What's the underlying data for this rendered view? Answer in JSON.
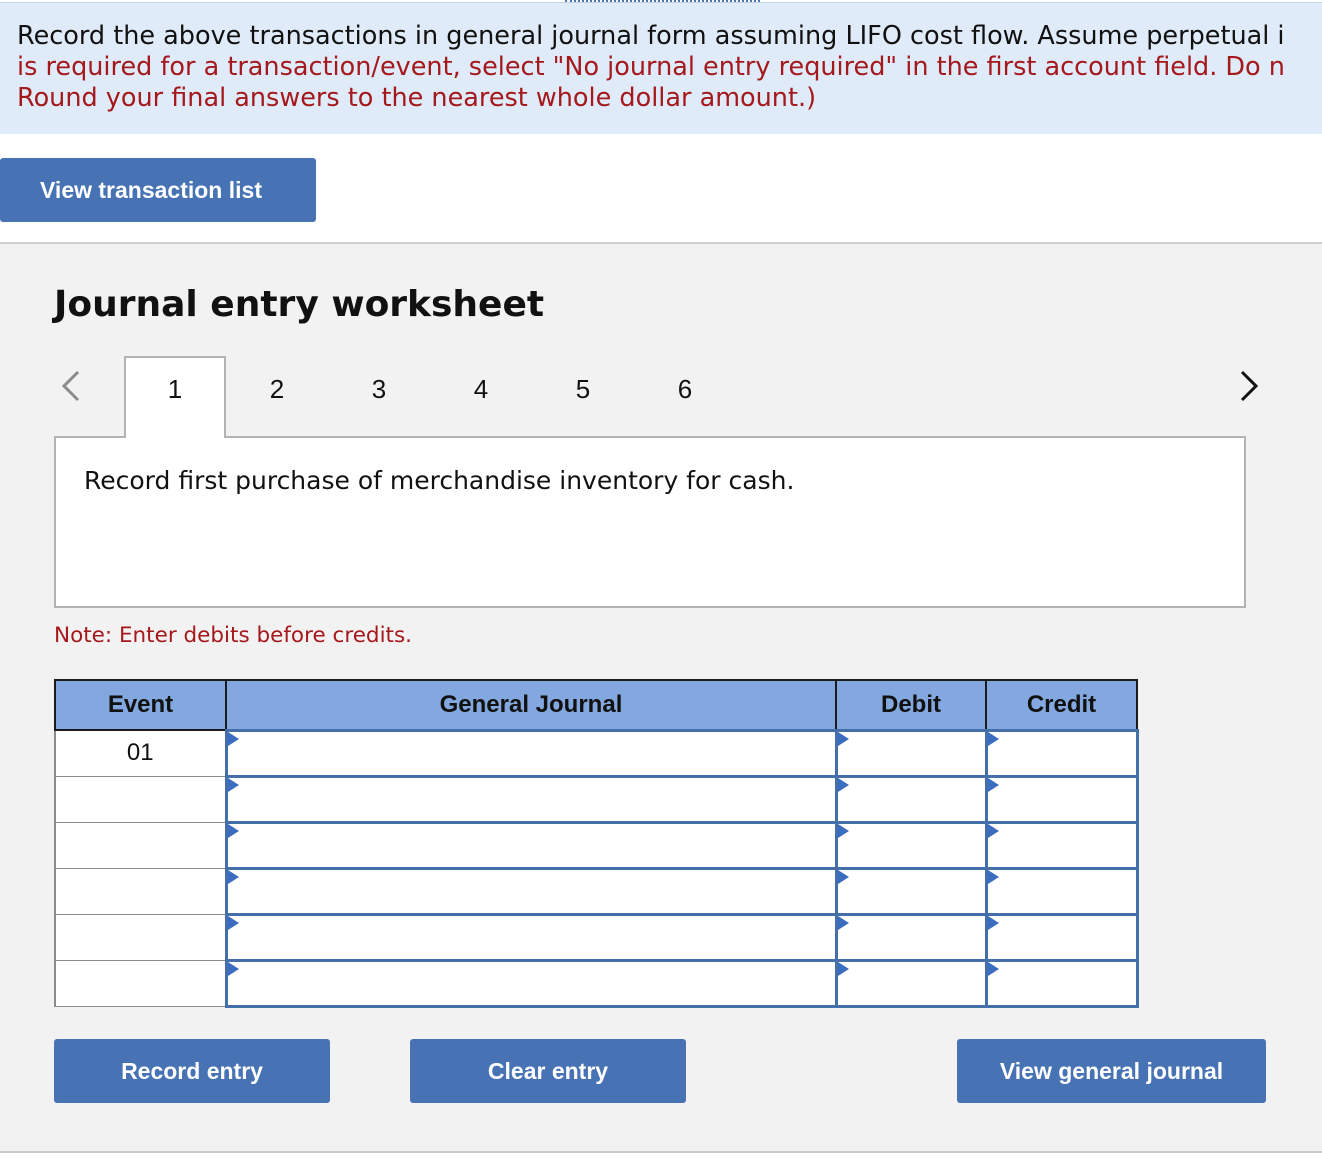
{
  "instructions": {
    "line1": "Record the above transactions in general journal form assuming LIFO cost flow. Assume perpetual i",
    "line2": "is required for a transaction/event, select \"No journal entry required\" in the first account field. Do n",
    "line3": "Round your final answers to the nearest whole dollar amount.)"
  },
  "view_transaction_list_label": "View transaction list",
  "worksheet": {
    "title": "Journal entry worksheet",
    "tabs": [
      "1",
      "2",
      "3",
      "4",
      "5",
      "6"
    ],
    "active_tab": "1",
    "description": "Record first purchase of merchandise inventory for cash.",
    "note": "Note: Enter debits before credits."
  },
  "table": {
    "headers": {
      "event": "Event",
      "journal": "General Journal",
      "debit": "Debit",
      "credit": "Credit"
    },
    "rows": [
      {
        "event": "01",
        "account": "",
        "debit": "",
        "credit": ""
      },
      {
        "event": "",
        "account": "",
        "debit": "",
        "credit": ""
      },
      {
        "event": "",
        "account": "",
        "debit": "",
        "credit": ""
      },
      {
        "event": "",
        "account": "",
        "debit": "",
        "credit": ""
      },
      {
        "event": "",
        "account": "",
        "debit": "",
        "credit": ""
      },
      {
        "event": "",
        "account": "",
        "debit": "",
        "credit": ""
      }
    ]
  },
  "buttons": {
    "record_entry": "Record entry",
    "clear_entry": "Clear entry",
    "view_general_journal": "View general journal"
  },
  "icons": {
    "prev": "chevron-left-icon",
    "next": "chevron-right-icon",
    "dropdown_marker": "dropdown-flag-icon"
  },
  "colors": {
    "button_bg": "#4773b5",
    "header_bg": "#82a8df",
    "instruction_bg": "#dfebf8",
    "warning_red": "#a5181c",
    "input_border": "#456fa8",
    "worksheet_bg": "#f2f2f2"
  }
}
